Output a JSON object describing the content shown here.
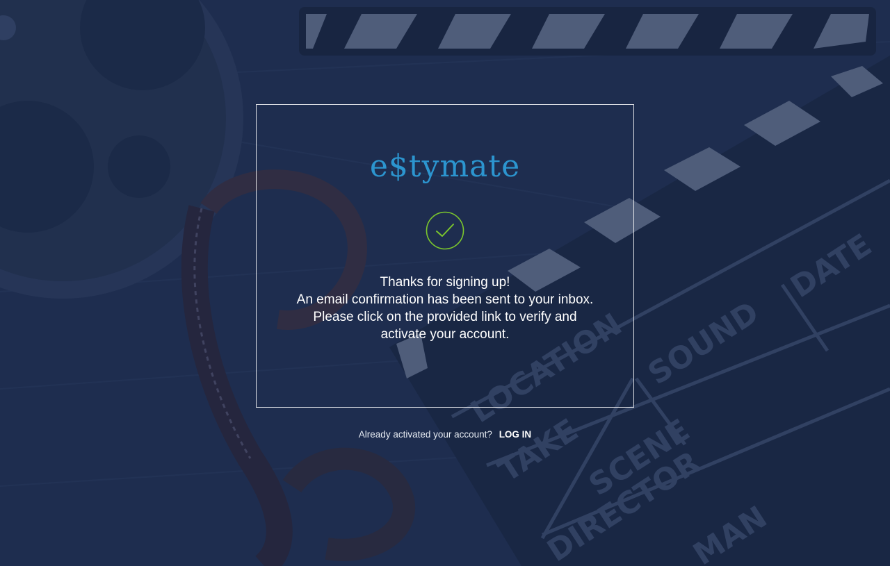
{
  "background": {
    "clapper_labels": [
      "LOCATION",
      "TAKE",
      "SCENE",
      "SOUND",
      "DATE",
      "DIRECTOR",
      "MAN"
    ]
  },
  "logo": {
    "text": "e$tymate"
  },
  "status": {
    "icon": "checkmark-icon",
    "color": "#7bc62d"
  },
  "message": {
    "line1": "Thanks for signing up!",
    "line2": "An email confirmation has been sent to your inbox.",
    "line3": "Please click on the provided link to verify and",
    "line4": "activate your account."
  },
  "login": {
    "prompt": "Already activated your  account?",
    "link_label": "LOG IN"
  },
  "colors": {
    "brand": "#2c95cf",
    "overlay": "#1c2c4c",
    "accent": "#7bc62d"
  }
}
